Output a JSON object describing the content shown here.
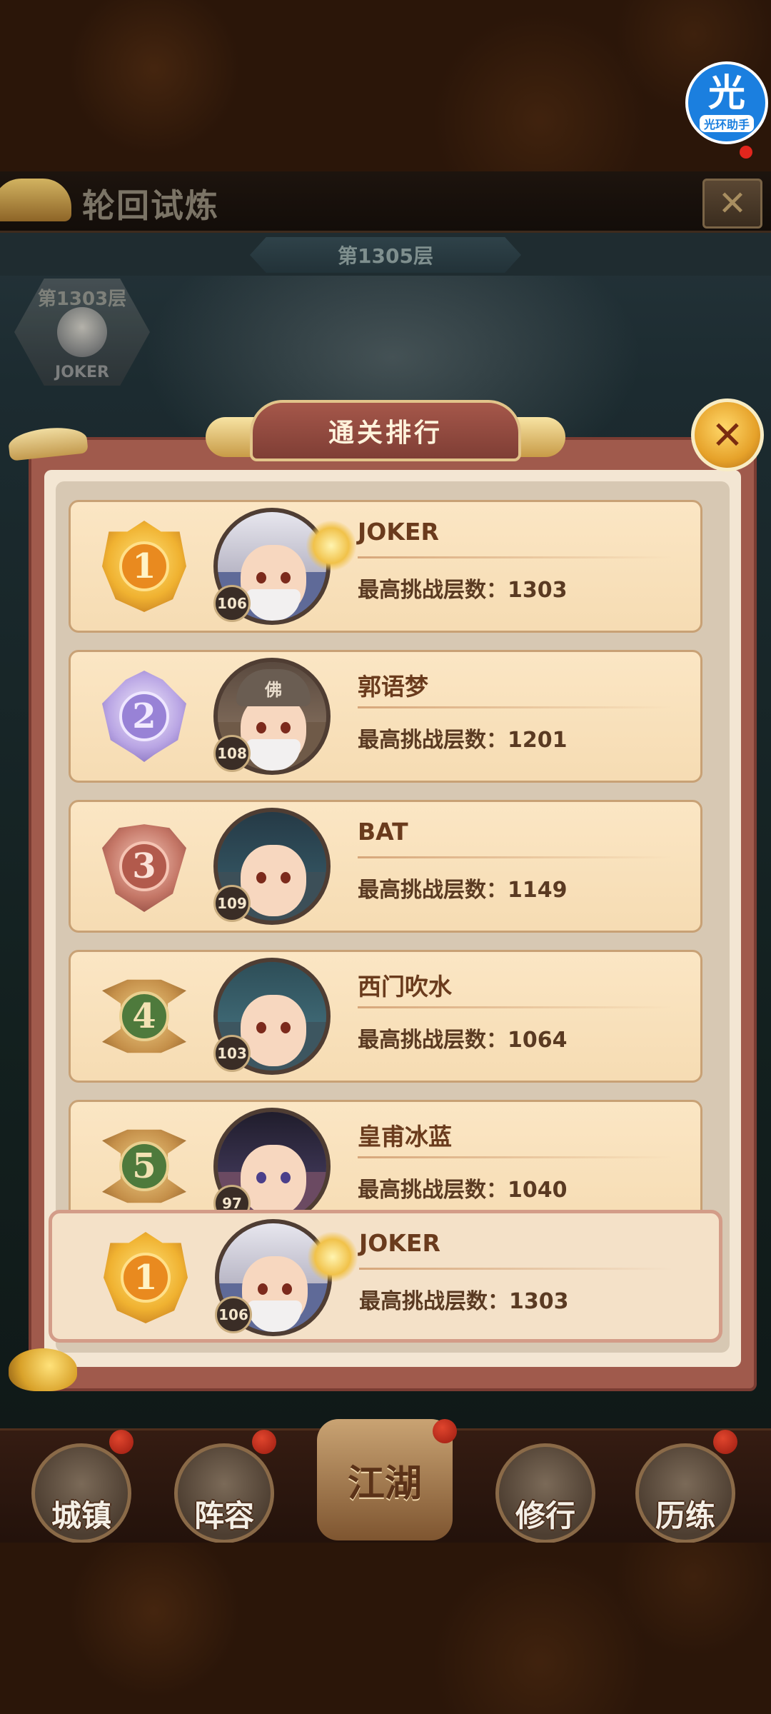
{
  "header": {
    "title": "轮回试炼",
    "close_icon": "close-x-icon"
  },
  "floor": {
    "current": "第1305层",
    "previous_label": "第1303层",
    "previous_player": "JOKER"
  },
  "panel": {
    "title": "通关排行",
    "close_icon": "close-x-icon"
  },
  "rankings": [
    {
      "rank": "1",
      "name": "JOKER",
      "level": "106",
      "stat": "最高挑战层数：1303"
    },
    {
      "rank": "2",
      "name": "郭语梦",
      "level": "108",
      "stat": "最高挑战层数：1201",
      "cap_text": "佛"
    },
    {
      "rank": "3",
      "name": "BAT",
      "level": "109",
      "stat": "最高挑战层数：1149"
    },
    {
      "rank": "4",
      "name": "西门吹水",
      "level": "103",
      "stat": "最高挑战层数：1064"
    },
    {
      "rank": "5",
      "name": "皇甫冰蓝",
      "level": "97",
      "stat": "最高挑战层数：1040"
    }
  ],
  "my_rank": {
    "rank": "1",
    "name": "JOKER",
    "level": "106",
    "stat": "最高挑战层数：1303"
  },
  "nav": {
    "items": [
      {
        "label": "城镇"
      },
      {
        "label": "阵容"
      },
      {
        "label": "江湖"
      },
      {
        "label": "修行"
      },
      {
        "label": "历练"
      }
    ]
  },
  "assistant": {
    "glyph": "光",
    "label": "光环助手"
  },
  "colors": {
    "panel_frame": "#a05a4c",
    "card_bg": "#fbe6c4",
    "text_brown": "#6a3b1d",
    "rank1_gold": "#f0b231",
    "rank2_purple": "#b9a5e4",
    "rank3_copper": "#c47666",
    "rank_other_green": "#4e7a3c"
  }
}
